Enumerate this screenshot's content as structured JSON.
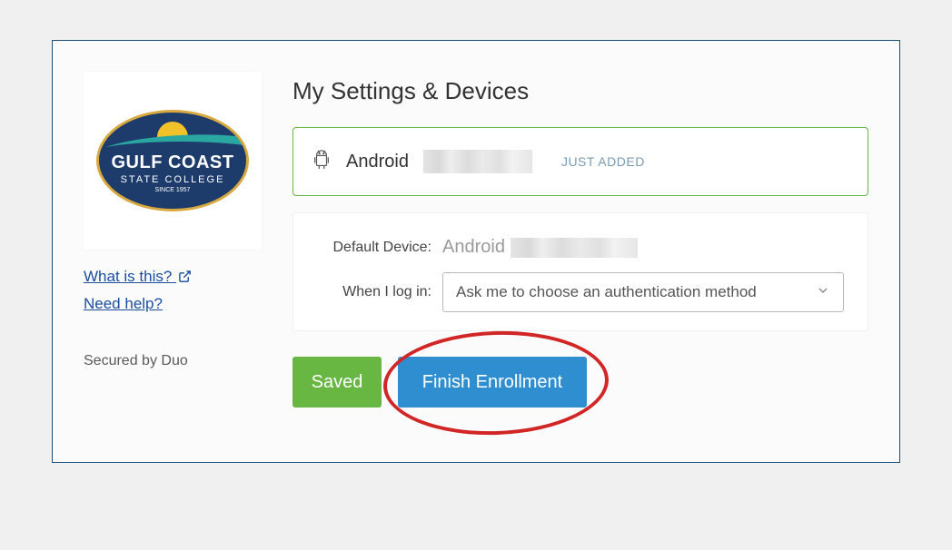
{
  "sidebar": {
    "logo": {
      "line1": "GULF COAST",
      "line2": "STATE COLLEGE",
      "since": "SINCE 1957"
    },
    "links": {
      "what_is_this": "What is this?",
      "need_help": "Need help?"
    },
    "secured_by": "Secured by Duo"
  },
  "main": {
    "title": "My Settings & Devices",
    "device": {
      "platform": "Android",
      "badge": "JUST ADDED"
    },
    "settings": {
      "default_device_label": "Default Device:",
      "default_device_value": "Android",
      "when_login_label": "When I log in:",
      "when_login_selected": "Ask me to choose an authentication method"
    },
    "buttons": {
      "saved": "Saved",
      "finish": "Finish Enrollment"
    }
  },
  "colors": {
    "frame_border": "#1a4d7a",
    "link": "#1a4d9e",
    "device_border": "#67b742",
    "saved_btn": "#67b742",
    "finish_btn": "#2f8ecf",
    "annotation": "#d22626"
  }
}
